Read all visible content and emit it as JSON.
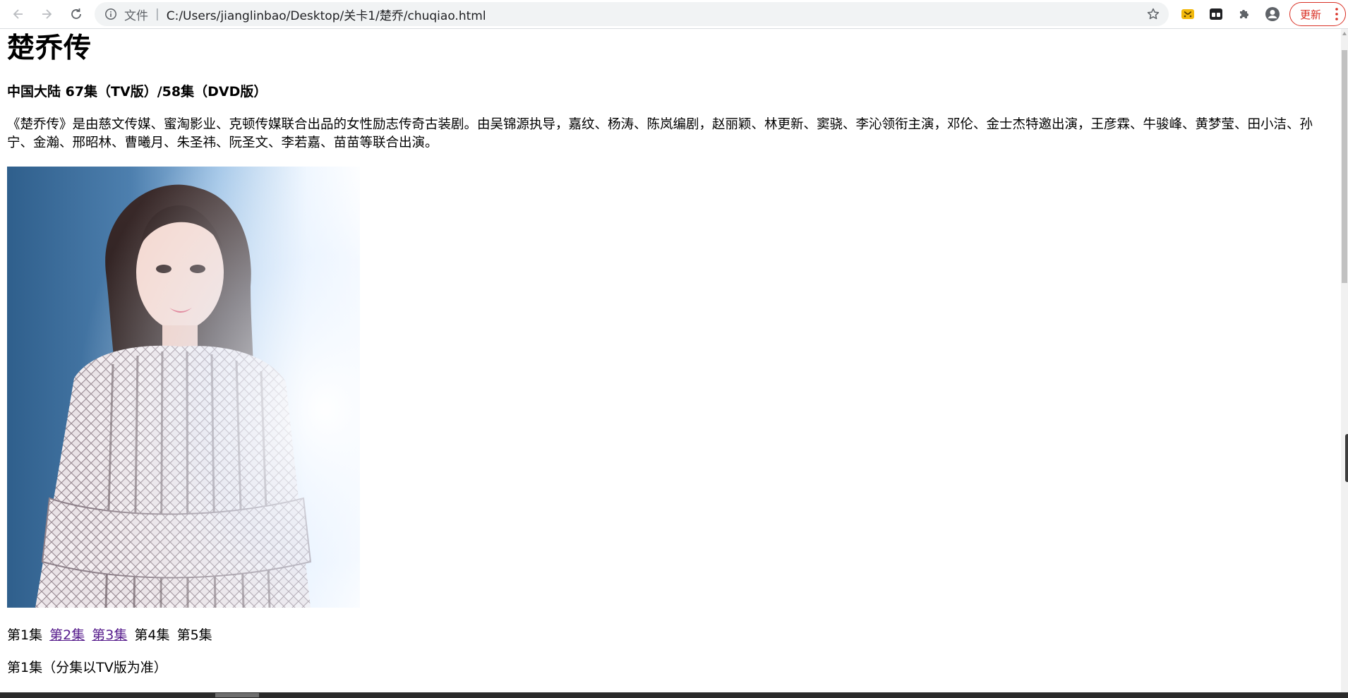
{
  "browser": {
    "back_icon": "arrow-left-icon",
    "forward_icon": "arrow-right-icon",
    "reload_icon": "reload-icon",
    "info_icon": "info-icon",
    "scheme_label": "文件",
    "url": "C:/Users/jianglinbao/Desktop/关卡1/楚乔/chuqiao.html",
    "bookmark_icon": "star-icon",
    "extensions": [
      "tampermonkey-icon",
      "media-extension-icon",
      "puzzle-icon",
      "profile-icon"
    ],
    "update_label": "更新",
    "update_color": "#d93025"
  },
  "page": {
    "title": "楚乔传",
    "subtitle": "中国大陆 67集（TV版）/58集（DVD版）",
    "description": "《楚乔传》是由慈文传媒、蜜淘影业、克顿传媒联合出品的女性励志传奇古装剧。由吴锦源执导，嘉纹、杨涛、陈岚编剧，赵丽颖、林更新、窦骁、李沁领衔主演，邓伦、金士杰特邀出演，王彦霖、牛骏峰、黄梦莹、田小洁、孙宁、金瀚、邢昭林、曹曦月、朱圣祎、阮圣文、李若嘉、苗苗等联合出演。",
    "episodes": [
      {
        "label": "第1集",
        "link": false
      },
      {
        "label": "第2集",
        "link": true
      },
      {
        "label": "第3集",
        "link": true
      },
      {
        "label": "第4集",
        "link": false
      },
      {
        "label": "第5集",
        "link": false
      }
    ],
    "episode_note": "第1集（分集以TV版为准）",
    "link_color": "#551a8b"
  }
}
